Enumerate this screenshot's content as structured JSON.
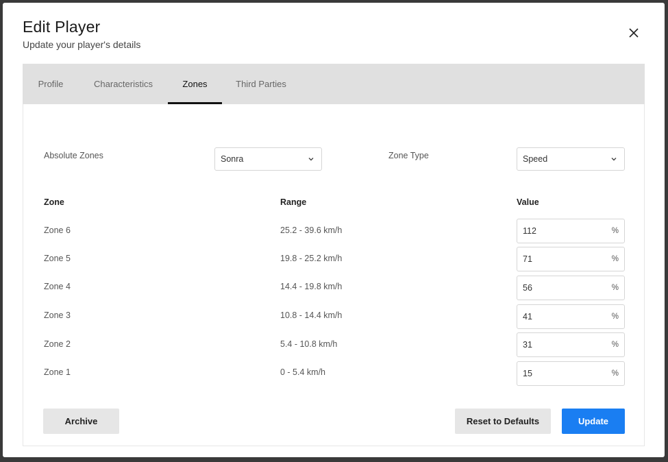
{
  "modal": {
    "title": "Edit Player",
    "subtitle": "Update your player's details"
  },
  "tabs": [
    {
      "label": "Profile",
      "active": false
    },
    {
      "label": "Characteristics",
      "active": false
    },
    {
      "label": "Zones",
      "active": true
    },
    {
      "label": "Third Parties",
      "active": false
    }
  ],
  "zones": {
    "absolute_zones_label": "Absolute Zones",
    "absolute_zones_value": "Sonra",
    "zone_type_label": "Zone Type",
    "zone_type_value": "Speed",
    "headers": {
      "zone": "Zone",
      "range": "Range",
      "value": "Value"
    },
    "rows": [
      {
        "zone": "Zone 6",
        "range": "25.2 - 39.6 km/h",
        "value": "112",
        "unit": "%"
      },
      {
        "zone": "Zone 5",
        "range": "19.8 - 25.2 km/h",
        "value": "71",
        "unit": "%"
      },
      {
        "zone": "Zone 4",
        "range": "14.4 - 19.8 km/h",
        "value": "56",
        "unit": "%"
      },
      {
        "zone": "Zone 3",
        "range": "10.8 - 14.4 km/h",
        "value": "41",
        "unit": "%"
      },
      {
        "zone": "Zone 2",
        "range": "5.4 - 10.8 km/h",
        "value": "31",
        "unit": "%"
      },
      {
        "zone": "Zone 1",
        "range": "0 - 5.4 km/h",
        "value": "15",
        "unit": "%"
      }
    ]
  },
  "buttons": {
    "archive": "Archive",
    "reset": "Reset to Defaults",
    "update": "Update"
  },
  "colors": {
    "accent": "#1a7ef2",
    "tab_bar": "#e0e0e0"
  }
}
